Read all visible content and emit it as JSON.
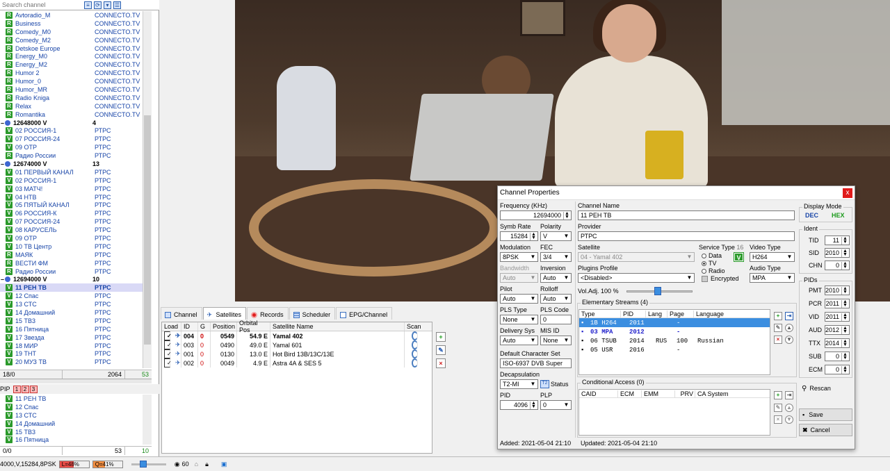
{
  "search": {
    "placeholder": "Search channel"
  },
  "channels": [
    {
      "type": "R",
      "name": "Avtoradio_M",
      "provider": "CONNECTO.TV"
    },
    {
      "type": "R",
      "name": "Business",
      "provider": "CONNECTO.TV"
    },
    {
      "type": "R",
      "name": "Comedy_M0",
      "provider": "CONNECTO.TV"
    },
    {
      "type": "R",
      "name": "Comedy_M2",
      "provider": "CONNECTO.TV"
    },
    {
      "type": "R",
      "name": "Detskoe Europe",
      "provider": "CONNECTO.TV"
    },
    {
      "type": "R",
      "name": "Energy_M0",
      "provider": "CONNECTO.TV"
    },
    {
      "type": "R",
      "name": "Energy_M2",
      "provider": "CONNECTO.TV"
    },
    {
      "type": "R",
      "name": "Humor 2",
      "provider": "CONNECTO.TV"
    },
    {
      "type": "R",
      "name": "Humor_0",
      "provider": "CONNECTO.TV"
    },
    {
      "type": "R",
      "name": "Humor_MR",
      "provider": "CONNECTO.TV"
    },
    {
      "type": "R",
      "name": "Radio Kniga",
      "provider": "CONNECTO.TV"
    },
    {
      "type": "R",
      "name": "Relax",
      "provider": "CONNECTO.TV"
    },
    {
      "type": "R",
      "name": "Romantika",
      "provider": "CONNECTO.TV"
    },
    {
      "type": "TP",
      "name": "12648000 V",
      "count": "4"
    },
    {
      "type": "V",
      "name": "02 РОССИЯ-1",
      "provider": "РТРС"
    },
    {
      "type": "V",
      "name": "07 РОССИЯ-24",
      "provider": "РТРС"
    },
    {
      "type": "V",
      "name": "09 ОТР",
      "provider": "РТРС"
    },
    {
      "type": "R",
      "name": "Радио России",
      "provider": "РТРС"
    },
    {
      "type": "TP",
      "name": "12674000 V",
      "count": "13"
    },
    {
      "type": "V",
      "name": "01 ПЕРВЫЙ КАНАЛ",
      "provider": "РТРС"
    },
    {
      "type": "V",
      "name": "02 РОССИЯ-1",
      "provider": "РТРС"
    },
    {
      "type": "V",
      "name": "03 МАТЧ!",
      "provider": "РТРС"
    },
    {
      "type": "V",
      "name": "04 НТВ",
      "provider": "РТРС"
    },
    {
      "type": "V",
      "name": "05 ПЯТЫЙ КАНАЛ",
      "provider": "РТРС"
    },
    {
      "type": "V",
      "name": "06 РОССИЯ-К",
      "provider": "РТРС"
    },
    {
      "type": "V",
      "name": "07 РОССИЯ-24",
      "provider": "РТРС"
    },
    {
      "type": "V",
      "name": "08 КАРУСЕЛЬ",
      "provider": "РТРС"
    },
    {
      "type": "V",
      "name": "09 ОТР",
      "provider": "РТРС"
    },
    {
      "type": "V",
      "name": "10 ТВ Центр",
      "provider": "РТРС"
    },
    {
      "type": "R",
      "name": "МАЯК",
      "provider": "РТРС"
    },
    {
      "type": "R",
      "name": "ВЕСТИ ФМ",
      "provider": "РТРС"
    },
    {
      "type": "R",
      "name": "Радио России",
      "provider": "РТРС"
    },
    {
      "type": "TP",
      "name": "12694000 V",
      "count": "10"
    },
    {
      "type": "V",
      "name": "11 РЕН ТВ",
      "provider": "РТРС",
      "selected": true
    },
    {
      "type": "V",
      "name": "12 Спас",
      "provider": "РТРС"
    },
    {
      "type": "V",
      "name": "13 СТС",
      "provider": "РТРС"
    },
    {
      "type": "V",
      "name": "14 Домашний",
      "provider": "РТРС"
    },
    {
      "type": "V",
      "name": "15 ТВ3",
      "provider": "РТРС"
    },
    {
      "type": "V",
      "name": "16 Пятница",
      "provider": "РТРС"
    },
    {
      "type": "V",
      "name": "17 Звезда",
      "provider": "РТРС"
    },
    {
      "type": "V",
      "name": "18 МИР",
      "provider": "РТРС"
    },
    {
      "type": "V",
      "name": "19 ТНТ",
      "provider": "РТРС"
    },
    {
      "type": "V",
      "name": "20 МУЗ ТВ",
      "provider": "РТРС"
    }
  ],
  "status1": {
    "a": "18/0",
    "b": "2064",
    "c": "53"
  },
  "pip": {
    "label": "PIP",
    "n1": "1",
    "n2": "2",
    "n3": "3"
  },
  "pip_channels": [
    "11 РЕН ТВ",
    "12 Спас",
    "13 СТС",
    "14 Домашний",
    "15 ТВ3",
    "16 Пятница"
  ],
  "status2": {
    "a": "0/0",
    "b": "53",
    "c": "10"
  },
  "tabs": [
    "Channel",
    "Satellites",
    "Records",
    "Scheduler",
    "EPG/Channel"
  ],
  "sat_headers": [
    "Load",
    "ID",
    "G",
    "Position",
    "Orbital Pos",
    "Satellite Name",
    "Scan"
  ],
  "satellites": [
    {
      "id": "004",
      "g": "0",
      "pos": "0549",
      "orb": "54.9 E",
      "name": "Yamal 402",
      "bold": true
    },
    {
      "id": "003",
      "g": "0",
      "pos": "0490",
      "orb": "49.0 E",
      "name": "Yamal 601",
      "bold": false
    },
    {
      "id": "001",
      "g": "0",
      "pos": "0130",
      "orb": "13.0 E",
      "name": "Hot Bird 13B/13C/13E",
      "bold": false
    },
    {
      "id": "002",
      "g": "0",
      "pos": "0049",
      "orb": "4.9 E",
      "name": "Astra 4A & SES 5",
      "bold": false
    }
  ],
  "dialog": {
    "title": "Channel Properties",
    "close": "x",
    "freq_label": "Frequency (KHz)",
    "freq": "12694000",
    "symb_label": "Symb Rate",
    "symb": "15284",
    "pol_label": "Polarity",
    "pol": "V",
    "mod_label": "Modulation",
    "mod": "8PSK",
    "fec_label": "FEC",
    "fec": "3/4",
    "bw_label": "Bandwidth",
    "bw": "Auto",
    "inv_label": "Inversion",
    "inv": "Auto",
    "pilot_label": "Pilot",
    "pilot": "Auto",
    "roll_label": "Rolloff",
    "roll": "Auto",
    "plst_label": "PLS Type",
    "plst": "None",
    "plsc_label": "PLS Code",
    "plsc": "0",
    "dsys_label": "Delivery Sys",
    "dsys": "Auto",
    "misid_label": "MIS ID",
    "misid": "None",
    "charset_label": "Default Character Set",
    "charset": "ISO-6937 DVB Super",
    "decap_label": "Decapsulation",
    "decap": "T2-MI",
    "status_btn": "Status",
    "pid_label": "PID",
    "pid": "4096",
    "plp_label": "PLP",
    "plp": "0",
    "name_label": "Channel Name",
    "name": "11 РЕН ТВ",
    "prov_label": "Provider",
    "prov": "РТРС",
    "sat_label": "Satellite",
    "sat": "04 - Yamal 402",
    "plug_label": "Plugins Profile",
    "plug": "<Disabled>",
    "vol_label": "Vol.Adj.",
    "vol": "100 %",
    "stype_label": "Service Type",
    "stype_num": "16",
    "st_data": "Data",
    "st_tv": "TV",
    "st_radio": "Radio",
    "encrypted": "Encrypted",
    "vtype_label": "Video Type",
    "vtype": "H264",
    "atype_label": "Audio Type",
    "atype": "MPA",
    "es_label": "Elementary Streams (4)",
    "es_headers": [
      "Type",
      "PID",
      "Lang",
      "Page",
      "Language"
    ],
    "streams": [
      {
        "type": "1B H264",
        "pid": "2011",
        "lang": "",
        "page": "-",
        "language": "",
        "cls": "hl"
      },
      {
        "type": "03 MPA",
        "pid": "2012",
        "lang": "",
        "page": "-",
        "language": "",
        "cls": "blue"
      },
      {
        "type": "06 TSUB",
        "pid": "2014",
        "lang": "RUS",
        "page": "100",
        "language": "Russian",
        "cls": ""
      },
      {
        "type": "05 USR",
        "pid": "2016",
        "lang": "",
        "page": "-",
        "language": "",
        "cls": ""
      }
    ],
    "ca_label": "Conditional Access (0)",
    "ca_headers": [
      "CAID",
      "ECM",
      "EMM",
      "PRV",
      "CA System"
    ],
    "disp_label": "Display Mode",
    "dec": "DEC",
    "hex": "HEX",
    "ident_label": "Ident",
    "tid_label": "TID",
    "tid": "11",
    "sid_label": "SID",
    "sid": "2010",
    "chn_label": "CHN",
    "chn": "0",
    "pids_label": "PIDs",
    "pmt_label": "PMT",
    "pmt": "2010",
    "pcr_label": "PCR",
    "pcr": "2011",
    "vid_label": "VID",
    "vid": "2011",
    "aud_label": "AUD",
    "aud": "2012",
    "ttx_label": "TTX",
    "ttx": "2014",
    "sub_label": "SUB",
    "sub": "0",
    "ecm_label": "ECM",
    "ecm": "0",
    "rescan": "Rescan",
    "save": "Save",
    "cancel": "Cancel",
    "added": "Added: 2021-05-04 21:10",
    "updated": "Updated: 2021-05-04 21:10"
  },
  "bottombar": {
    "tp": "4000,V,15284,8PSK",
    "l": "L=48%",
    "l_level": 0.48,
    "q": "Q=41%",
    "q_level": 0.41,
    "vol": "60"
  }
}
